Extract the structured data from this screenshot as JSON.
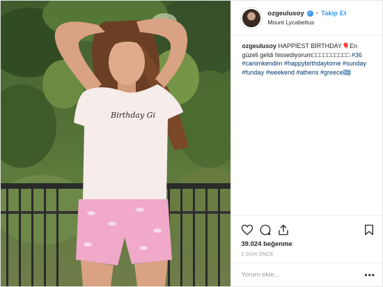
{
  "post": {
    "username": "ozgeulusoy",
    "follow_label": "Takip Et",
    "location": "Mount Lycabettus",
    "caption": {
      "username": "ozgeulusoy",
      "text": "HAPPİEST BİRTHDAY🎈En güzeli geldi hissediyorum",
      "symbols": "□□□□□□□□□□",
      "hashtags": [
        "#36",
        "#canimkendim",
        "#happybirthdaytome",
        "#sunday",
        "#funday",
        "#weekend",
        "#athens",
        "#greece"
      ],
      "trailing_symbol": "🇬🇷"
    },
    "likes_text": "39.024 beğenme",
    "time_text": "1 GÜN ÖNCE",
    "comment_placeholder": "Yorum ekle...",
    "more_label": "•••",
    "shirt_text": "Birthday Gi"
  },
  "icons": {
    "verified": "verified-badge-icon",
    "like": "heart-icon",
    "comment": "comment-bubble-icon",
    "share": "share-icon",
    "save": "bookmark-icon"
  },
  "colors": {
    "link": "#3897f0",
    "hashtag": "#003569",
    "muted": "#999999",
    "border": "#efefef"
  }
}
